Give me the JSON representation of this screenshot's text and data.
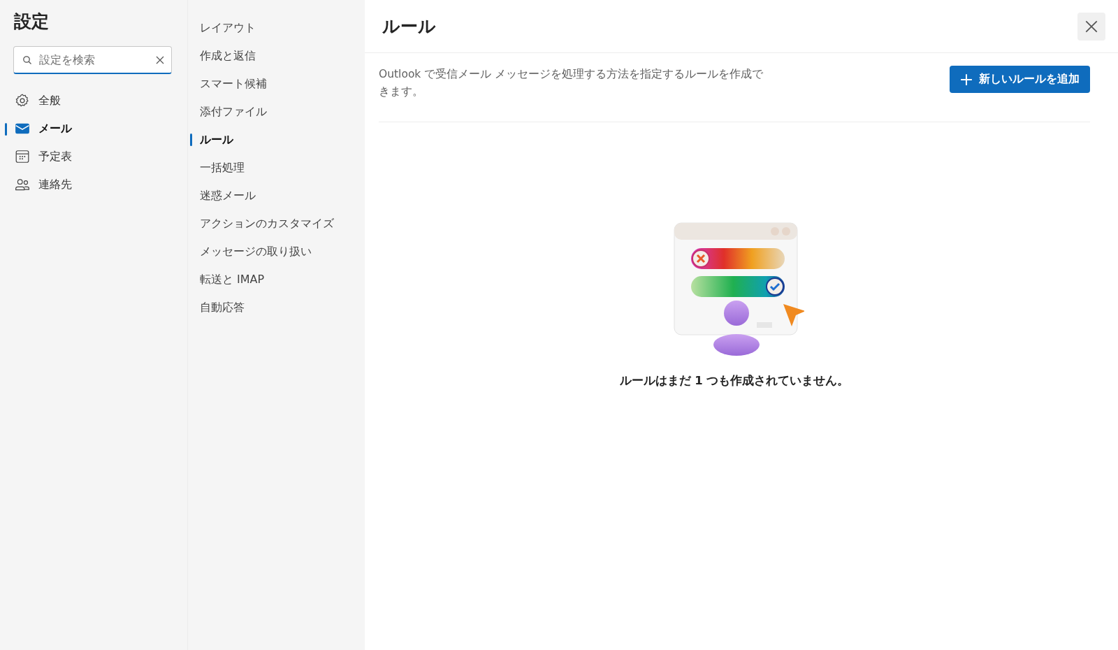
{
  "sidebar": {
    "title": "設定",
    "search": {
      "placeholder": "設定を検索"
    },
    "items": [
      {
        "label": "全般",
        "selected": false
      },
      {
        "label": "メール",
        "selected": true
      },
      {
        "label": "予定表",
        "selected": false
      },
      {
        "label": "連絡先",
        "selected": false
      }
    ]
  },
  "subnav": {
    "items": [
      {
        "label": "レイアウト",
        "selected": false
      },
      {
        "label": "作成と返信",
        "selected": false
      },
      {
        "label": "スマート候補",
        "selected": false
      },
      {
        "label": "添付ファイル",
        "selected": false
      },
      {
        "label": "ルール",
        "selected": true
      },
      {
        "label": "一括処理",
        "selected": false
      },
      {
        "label": "迷惑メール",
        "selected": false
      },
      {
        "label": "アクションのカスタマイズ",
        "selected": false
      },
      {
        "label": "メッセージの取り扱い",
        "selected": false
      },
      {
        "label": "転送と IMAP",
        "selected": false
      },
      {
        "label": "自動応答",
        "selected": false
      }
    ]
  },
  "main": {
    "title": "ルール",
    "description": "Outlook で受信メール メッセージを処理する方法を指定するルールを作成できます。",
    "add_button": "新しいルールを追加",
    "empty_message": "ルールはまだ 1 つも作成されていません。"
  }
}
